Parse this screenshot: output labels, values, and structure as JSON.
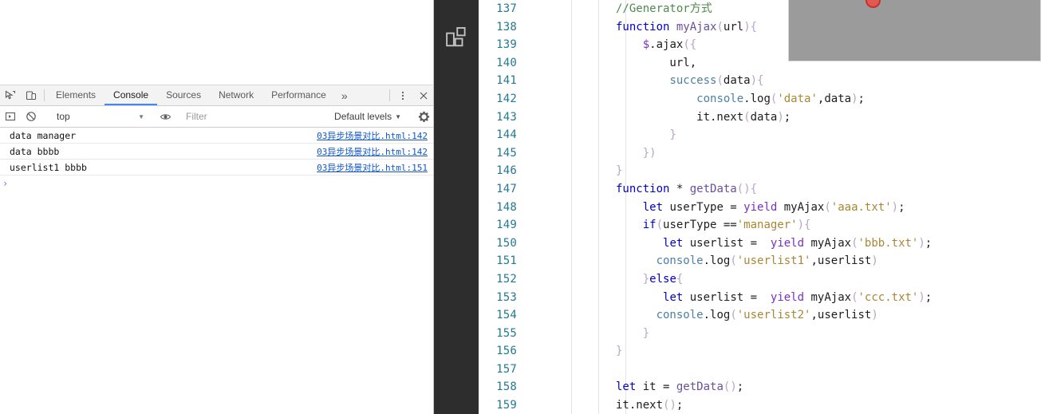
{
  "devtools": {
    "toolbar": {
      "inspect_icon": "inspect-element-icon",
      "device_icon": "device-toolbar-icon",
      "more_tabs_label": "»",
      "more_options_icon": "kebab-menu-icon",
      "close_icon": "close-icon",
      "tabs": [
        {
          "label": "Elements",
          "active": false
        },
        {
          "label": "Console",
          "active": true
        },
        {
          "label": "Sources",
          "active": false
        },
        {
          "label": "Network",
          "active": false
        },
        {
          "label": "Performance",
          "active": false
        }
      ]
    },
    "filterbar": {
      "execute_icon": "execute-sidebar-icon",
      "clear_icon": "clear-console-icon",
      "context_value": "top",
      "eye_icon": "live-expression-icon",
      "filter_placeholder": "Filter",
      "filter_value": "",
      "levels_label": "Default levels",
      "settings_icon": "gear-icon",
      "caret": "▼"
    },
    "console": {
      "messages": [
        {
          "text": "data manager",
          "source": "03异步场景对比.html:142"
        },
        {
          "text": "data bbbb",
          "source": "03异步场景对比.html:142"
        },
        {
          "text": "userlist1 bbbb",
          "source": "03异步场景对比.html:151"
        }
      ],
      "prompt_symbol": "›"
    }
  },
  "activitybar": {
    "items": [
      {
        "icon": "extensions-blocks-icon",
        "label": "Extensions"
      }
    ]
  },
  "editor": {
    "first_line_number": 137,
    "lines": [
      {
        "no": "137",
        "tokens": [
          {
            "t": "//Generator方式",
            "c": "tok-cmt"
          }
        ],
        "indent": 0
      },
      {
        "no": "138",
        "tokens": [
          {
            "t": "function",
            "c": "tok-kw"
          },
          {
            "t": " ",
            "c": "tok-id"
          },
          {
            "t": "myAjax",
            "c": "tok-fn"
          },
          {
            "t": "(",
            "c": "tok-par"
          },
          {
            "t": "url",
            "c": "tok-id"
          },
          {
            "t": ")",
            "c": "tok-par"
          },
          {
            "t": "{",
            "c": "tok-par"
          }
        ],
        "indent": 0
      },
      {
        "no": "139",
        "tokens": [
          {
            "t": "    ",
            "c": "tok-id"
          },
          {
            "t": "$",
            "c": "tok-kw2"
          },
          {
            "t": ".ajax",
            "c": "tok-id"
          },
          {
            "t": "(",
            "c": "tok-par"
          },
          {
            "t": "{",
            "c": "tok-par"
          }
        ],
        "indent": 1
      },
      {
        "no": "140",
        "tokens": [
          {
            "t": "        url,",
            "c": "tok-id"
          }
        ],
        "indent": 2
      },
      {
        "no": "141",
        "tokens": [
          {
            "t": "        ",
            "c": "tok-id"
          },
          {
            "t": "success",
            "c": "tok-prop"
          },
          {
            "t": "(",
            "c": "tok-par"
          },
          {
            "t": "data",
            "c": "tok-id"
          },
          {
            "t": ")",
            "c": "tok-par"
          },
          {
            "t": "{",
            "c": "tok-par"
          }
        ],
        "indent": 2
      },
      {
        "no": "142",
        "tokens": [
          {
            "t": "            ",
            "c": "tok-id"
          },
          {
            "t": "console",
            "c": "tok-prop"
          },
          {
            "t": ".log",
            "c": "tok-id"
          },
          {
            "t": "(",
            "c": "tok-par"
          },
          {
            "t": "'data'",
            "c": "tok-str"
          },
          {
            "t": ",",
            "c": "tok-id"
          },
          {
            "t": "data",
            "c": "tok-id"
          },
          {
            "t": ")",
            "c": "tok-par"
          },
          {
            "t": ";",
            "c": "tok-id"
          }
        ],
        "indent": 3
      },
      {
        "no": "143",
        "tokens": [
          {
            "t": "            it.next",
            "c": "tok-id"
          },
          {
            "t": "(",
            "c": "tok-par"
          },
          {
            "t": "data",
            "c": "tok-id"
          },
          {
            "t": ")",
            "c": "tok-par"
          },
          {
            "t": ";",
            "c": "tok-id"
          }
        ],
        "indent": 3
      },
      {
        "no": "144",
        "tokens": [
          {
            "t": "        ",
            "c": "tok-id"
          },
          {
            "t": "}",
            "c": "tok-par"
          }
        ],
        "indent": 2
      },
      {
        "no": "145",
        "tokens": [
          {
            "t": "    ",
            "c": "tok-id"
          },
          {
            "t": "})",
            "c": "tok-par"
          }
        ],
        "indent": 1
      },
      {
        "no": "146",
        "tokens": [
          {
            "t": "}",
            "c": "tok-par"
          }
        ],
        "indent": 0
      },
      {
        "no": "147",
        "tokens": [
          {
            "t": "function",
            "c": "tok-kw"
          },
          {
            "t": " * ",
            "c": "tok-id"
          },
          {
            "t": "getData",
            "c": "tok-fn"
          },
          {
            "t": "(",
            "c": "tok-par"
          },
          {
            "t": ")",
            "c": "tok-par"
          },
          {
            "t": "{",
            "c": "tok-par"
          }
        ],
        "indent": 0
      },
      {
        "no": "148",
        "tokens": [
          {
            "t": "    ",
            "c": "tok-id"
          },
          {
            "t": "let",
            "c": "tok-kw"
          },
          {
            "t": " userType = ",
            "c": "tok-id"
          },
          {
            "t": "yield",
            "c": "tok-kw2"
          },
          {
            "t": " myAjax",
            "c": "tok-id"
          },
          {
            "t": "(",
            "c": "tok-par"
          },
          {
            "t": "'aaa.txt'",
            "c": "tok-str"
          },
          {
            "t": ")",
            "c": "tok-par"
          },
          {
            "t": ";",
            "c": "tok-id"
          }
        ],
        "indent": 1
      },
      {
        "no": "149",
        "tokens": [
          {
            "t": "    ",
            "c": "tok-id"
          },
          {
            "t": "if",
            "c": "tok-kw"
          },
          {
            "t": "(",
            "c": "tok-par"
          },
          {
            "t": "userType ==",
            "c": "tok-id"
          },
          {
            "t": "'manager'",
            "c": "tok-str"
          },
          {
            "t": ")",
            "c": "tok-par"
          },
          {
            "t": "{",
            "c": "tok-par"
          }
        ],
        "indent": 1
      },
      {
        "no": "150",
        "tokens": [
          {
            "t": "       ",
            "c": "tok-id"
          },
          {
            "t": "let",
            "c": "tok-kw"
          },
          {
            "t": " userlist =  ",
            "c": "tok-id"
          },
          {
            "t": "yield",
            "c": "tok-kw2"
          },
          {
            "t": " myAjax",
            "c": "tok-id"
          },
          {
            "t": "(",
            "c": "tok-par"
          },
          {
            "t": "'bbb.txt'",
            "c": "tok-str"
          },
          {
            "t": ")",
            "c": "tok-par"
          },
          {
            "t": ";",
            "c": "tok-id"
          }
        ],
        "indent": 2
      },
      {
        "no": "151",
        "tokens": [
          {
            "t": "      ",
            "c": "tok-id"
          },
          {
            "t": "console",
            "c": "tok-prop"
          },
          {
            "t": ".log",
            "c": "tok-id"
          },
          {
            "t": "(",
            "c": "tok-par"
          },
          {
            "t": "'userlist1'",
            "c": "tok-str"
          },
          {
            "t": ",userlist",
            "c": "tok-id"
          },
          {
            "t": ")",
            "c": "tok-par"
          }
        ],
        "indent": 2
      },
      {
        "no": "152",
        "tokens": [
          {
            "t": "    ",
            "c": "tok-id"
          },
          {
            "t": "}",
            "c": "tok-par"
          },
          {
            "t": "else",
            "c": "tok-kw"
          },
          {
            "t": "{",
            "c": "tok-par"
          }
        ],
        "indent": 1
      },
      {
        "no": "153",
        "tokens": [
          {
            "t": "       ",
            "c": "tok-id"
          },
          {
            "t": "let",
            "c": "tok-kw"
          },
          {
            "t": " userlist =  ",
            "c": "tok-id"
          },
          {
            "t": "yield",
            "c": "tok-kw2"
          },
          {
            "t": " myAjax",
            "c": "tok-id"
          },
          {
            "t": "(",
            "c": "tok-par"
          },
          {
            "t": "'ccc.txt'",
            "c": "tok-str"
          },
          {
            "t": ")",
            "c": "tok-par"
          },
          {
            "t": ";",
            "c": "tok-id"
          }
        ],
        "indent": 2
      },
      {
        "no": "154",
        "tokens": [
          {
            "t": "      ",
            "c": "tok-id"
          },
          {
            "t": "console",
            "c": "tok-prop"
          },
          {
            "t": ".log",
            "c": "tok-id"
          },
          {
            "t": "(",
            "c": "tok-par"
          },
          {
            "t": "'userlist2'",
            "c": "tok-str"
          },
          {
            "t": ",userlist",
            "c": "tok-id"
          },
          {
            "t": ")",
            "c": "tok-par"
          }
        ],
        "indent": 2
      },
      {
        "no": "155",
        "tokens": [
          {
            "t": "    ",
            "c": "tok-id"
          },
          {
            "t": "}",
            "c": "tok-par"
          }
        ],
        "indent": 1
      },
      {
        "no": "156",
        "tokens": [
          {
            "t": "}",
            "c": "tok-par"
          }
        ],
        "indent": 0
      },
      {
        "no": "157",
        "tokens": [],
        "indent": 0
      },
      {
        "no": "158",
        "tokens": [
          {
            "t": "let",
            "c": "tok-kw"
          },
          {
            "t": " it = ",
            "c": "tok-id"
          },
          {
            "t": "getData",
            "c": "tok-fn"
          },
          {
            "t": "(",
            "c": "tok-par"
          },
          {
            "t": ")",
            "c": "tok-par"
          },
          {
            "t": ";",
            "c": "tok-id"
          }
        ],
        "indent": 0
      },
      {
        "no": "159",
        "tokens": [
          {
            "t": "it.next",
            "c": "tok-id"
          },
          {
            "t": "(",
            "c": "tok-par"
          },
          {
            "t": ")",
            "c": "tok-par"
          },
          {
            "t": ";",
            "c": "tok-id"
          }
        ],
        "indent": 0
      }
    ]
  },
  "overlay": {
    "panel_color": "#9b9b9b",
    "marker_color": "#e05a52",
    "marker_name": "red-circle-marker"
  }
}
